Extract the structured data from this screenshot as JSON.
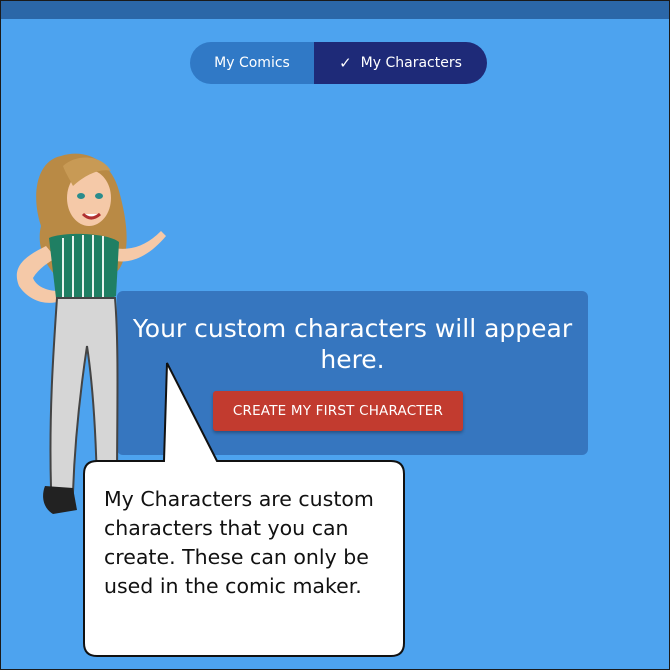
{
  "tabs": [
    {
      "label": "My Comics",
      "active": false
    },
    {
      "label": "My Characters",
      "active": true
    }
  ],
  "check_icon": "checkmark-icon",
  "panel": {
    "message": "Your custom characters will appear here.",
    "button_label": "CREATE MY FIRST CHARACTER"
  },
  "bubble": {
    "text": "My Characters are custom characters that you can create. These can only be used in the comic maker."
  },
  "colors": {
    "background": "#4da3ef",
    "topbar": "#2b67a8",
    "tab_inactive": "#3079c6",
    "tab_active": "#1e2a78",
    "panel": "#3676bf",
    "button": "#c23b2f"
  }
}
